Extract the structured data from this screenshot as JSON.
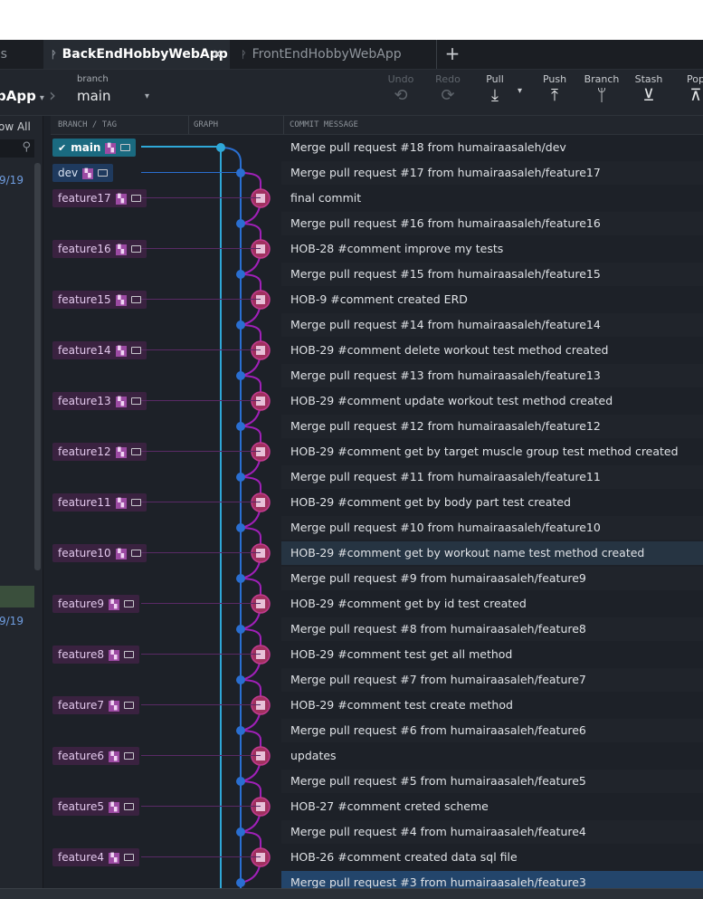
{
  "tabs": [
    {
      "label": "es"
    },
    {
      "label": "BackEndHobbyWebApp",
      "close": "×"
    },
    {
      "label": "FrontEndHobbyWebApp"
    }
  ],
  "tab_add": "+",
  "toolbar": {
    "repo": "bApp",
    "repo_caret": "▾",
    "chevron": "›",
    "branch_caption": "branch",
    "branch_name": "main",
    "branch_caret": "▾",
    "undo": "Undo",
    "redo": "Redo",
    "pull": "Pull",
    "pull_caret": "▾",
    "push": "Push",
    "branch": "Branch",
    "stash": "Stash",
    "pop": "Pop"
  },
  "left_panel": {
    "show_all": "ow All",
    "count_1": "9/19",
    "count_2": "9/19"
  },
  "columns": {
    "branch_tag": "BRANCH / TAG",
    "graph": "GRAPH",
    "commit_message": "COMMIT MESSAGE"
  },
  "commits": [
    {
      "label": "main",
      "label_type": "main",
      "message": "Merge pull request #18 from humairaasaleh/dev"
    },
    {
      "label": "dev",
      "label_type": "dev",
      "message": "Merge pull request #17 from humairaasaleh/feature17"
    },
    {
      "label": "feature17",
      "label_type": "feature",
      "message": "final commit"
    },
    {
      "label": "",
      "label_type": "",
      "message": "Merge pull request #16 from humairaasaleh/feature16"
    },
    {
      "label": "feature16",
      "label_type": "feature",
      "message": "HOB-28 #comment improve my tests"
    },
    {
      "label": "",
      "label_type": "",
      "message": "Merge pull request #15 from humairaasaleh/feature15"
    },
    {
      "label": "feature15",
      "label_type": "feature",
      "message": "HOB-9 #comment created ERD"
    },
    {
      "label": "",
      "label_type": "",
      "message": "Merge pull request #14 from humairaasaleh/feature14"
    },
    {
      "label": "feature14",
      "label_type": "feature",
      "message": "HOB-29 #comment delete workout test method created"
    },
    {
      "label": "",
      "label_type": "",
      "message": "Merge pull request #13 from humairaasaleh/feature13"
    },
    {
      "label": "feature13",
      "label_type": "feature",
      "message": "HOB-29 #comment update workout test method created"
    },
    {
      "label": "",
      "label_type": "",
      "message": "Merge pull request #12 from humairaasaleh/feature12"
    },
    {
      "label": "feature12",
      "label_type": "feature",
      "message": "HOB-29 #comment get by target muscle group test method created"
    },
    {
      "label": "",
      "label_type": "",
      "message": "Merge pull request #11 from humairaasaleh/feature11"
    },
    {
      "label": "feature11",
      "label_type": "feature",
      "message": "HOB-29 #comment get by body part test created"
    },
    {
      "label": "",
      "label_type": "",
      "message": "Merge pull request #10 from humairaasaleh/feature10"
    },
    {
      "label": "feature10",
      "label_type": "feature",
      "message": "HOB-29 #comment get by workout name test method created"
    },
    {
      "label": "",
      "label_type": "",
      "message": "Merge pull request #9 from humairaasaleh/feature9"
    },
    {
      "label": "feature9",
      "label_type": "feature",
      "message": "HOB-29 #comment get by id test created"
    },
    {
      "label": "",
      "label_type": "",
      "message": "Merge pull request #8 from humairaasaleh/feature8"
    },
    {
      "label": "feature8",
      "label_type": "feature",
      "message": "HOB-29 #comment test get all method"
    },
    {
      "label": "",
      "label_type": "",
      "message": "Merge pull request #7 from humairaasaleh/feature7"
    },
    {
      "label": "feature7",
      "label_type": "feature",
      "message": "HOB-29 #comment test create method"
    },
    {
      "label": "",
      "label_type": "",
      "message": "Merge pull request #6 from humairaasaleh/feature6"
    },
    {
      "label": "feature6",
      "label_type": "feature",
      "message": "updates"
    },
    {
      "label": "",
      "label_type": "",
      "message": "Merge pull request #5 from humairaasaleh/feature5"
    },
    {
      "label": "feature5",
      "label_type": "feature",
      "message": "HOB-27 #comment creted scheme"
    },
    {
      "label": "",
      "label_type": "",
      "message": "Merge pull request #4 from humairaasaleh/feature4"
    },
    {
      "label": "feature4",
      "label_type": "feature",
      "message": "HOB-26 #comment created data sql file"
    },
    {
      "label": "",
      "label_type": "",
      "message": "Merge pull request #3 from humairaasaleh/feature3"
    }
  ],
  "selected_row": 16,
  "last_row_highlight": 29,
  "colors": {
    "main_branch": "#2fa8d8",
    "dev_branch": "#2a6fd1",
    "feature_branch": "#a020b8",
    "avatar": "#a0315f"
  }
}
